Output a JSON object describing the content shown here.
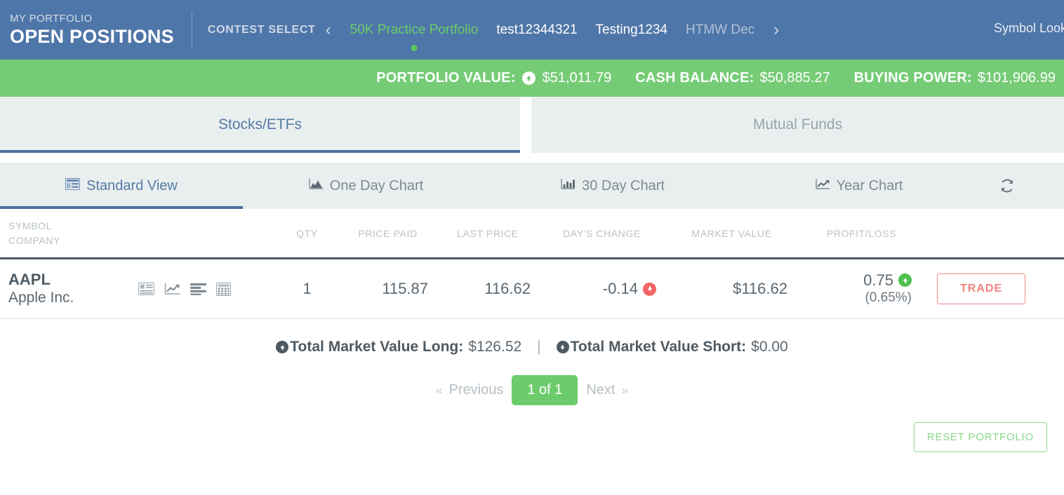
{
  "header": {
    "eyebrow": "MY PORTFOLIO",
    "title": "OPEN POSITIONS",
    "contest_select_label": "CONTEST SELECT",
    "prev_arrow": "‹",
    "next_arrow": "›",
    "contests": [
      {
        "label": "50K Practice Portfolio",
        "active": true
      },
      {
        "label": "test12344321",
        "active": false
      },
      {
        "label": "Testing1234",
        "active": false
      },
      {
        "label": "HTMW Dec",
        "active": false
      }
    ],
    "symbol_lookup": "Symbol Look"
  },
  "stats": {
    "portfolio_value_label": "PORTFOLIO VALUE:",
    "portfolio_value": "$51,011.79",
    "portfolio_value_direction": "up",
    "cash_balance_label": "CASH BALANCE:",
    "cash_balance": "$50,885.27",
    "buying_power_label": "BUYING POWER:",
    "buying_power": "$101,906.99",
    "bar_color": "#76cc76"
  },
  "main_tabs": [
    {
      "label": "Stocks/ETFs",
      "active": true
    },
    {
      "label": "Mutual Funds",
      "active": false
    }
  ],
  "view_tabs": [
    {
      "label": "Standard View",
      "icon": "table-icon",
      "active": true
    },
    {
      "label": "One Day Chart",
      "icon": "area-chart-icon",
      "active": false
    },
    {
      "label": "30 Day Chart",
      "icon": "bar-chart-icon",
      "active": false
    },
    {
      "label": "Year Chart",
      "icon": "line-chart-icon",
      "active": false
    }
  ],
  "refresh_icon": "refresh-icon",
  "table": {
    "columns": {
      "symbol_line1": "SYMBOL",
      "symbol_line2": "COMPANY",
      "qty": "QTY",
      "price_paid": "PRICE PAID",
      "last_price": "LAST PRICE",
      "days_change": "DAY'S CHANGE",
      "market_value": "MARKET VALUE",
      "profit_loss": "PROFIT/LOSS"
    },
    "rows": [
      {
        "symbol": "AAPL",
        "company": "Apple Inc.",
        "row_icons": [
          "news-icon",
          "chart-line-icon",
          "list-icon",
          "calculator-icon"
        ],
        "qty": "1",
        "price_paid": "115.87",
        "last_price": "116.62",
        "days_change": "-0.14",
        "days_change_direction": "down",
        "market_value": "$116.62",
        "profit_loss": "0.75",
        "profit_loss_pct": "(0.65%)",
        "profit_loss_direction": "up",
        "trade_label": "TRADE"
      }
    ]
  },
  "totals": {
    "long_label": "Total Market Value Long:",
    "long_value": "$126.52",
    "separator": "|",
    "short_label": "Total Market Value Short:",
    "short_value": "$0.00"
  },
  "pagination": {
    "previous": "Previous",
    "prev_chevron": "«",
    "current": "1 of 1",
    "next": "Next",
    "next_chevron": "»"
  },
  "reset_button": "RESET PORTFOLIO"
}
